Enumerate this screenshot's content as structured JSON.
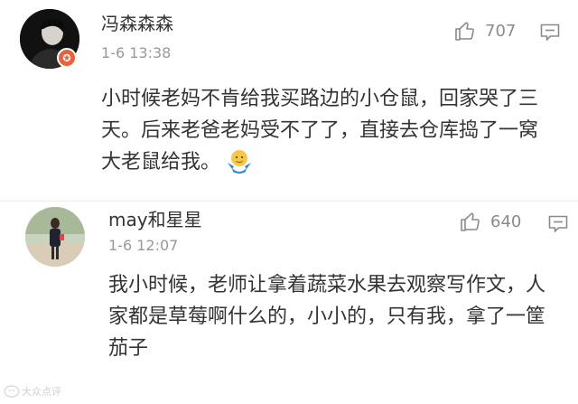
{
  "comments": [
    {
      "username": "冯森森森",
      "time": "1-6 13:38",
      "likes": "707",
      "verified": true,
      "content": "小时候老妈不肯给我买路边的小仓鼠，回家哭了三天。后来老爸老妈受不了了，直接去仓库捣了一窝大老鼠给我。",
      "emoji": "shrug-emoji"
    },
    {
      "username": "may和星星",
      "time": "1-6 12:07",
      "likes": "640",
      "verified": false,
      "content": "我小时候，老师让拿着蔬菜水果去观察写作文，人家都是草莓啊什么的，小小的，只有我，拿了一筐茄子"
    }
  ],
  "watermark": "大众点评",
  "colors": {
    "text": "#333333",
    "meta": "#999999",
    "icon": "#8a8a8a",
    "badge": "#e8613a"
  },
  "icons": [
    "like-icon",
    "reply-icon",
    "verified-badge-icon"
  ]
}
